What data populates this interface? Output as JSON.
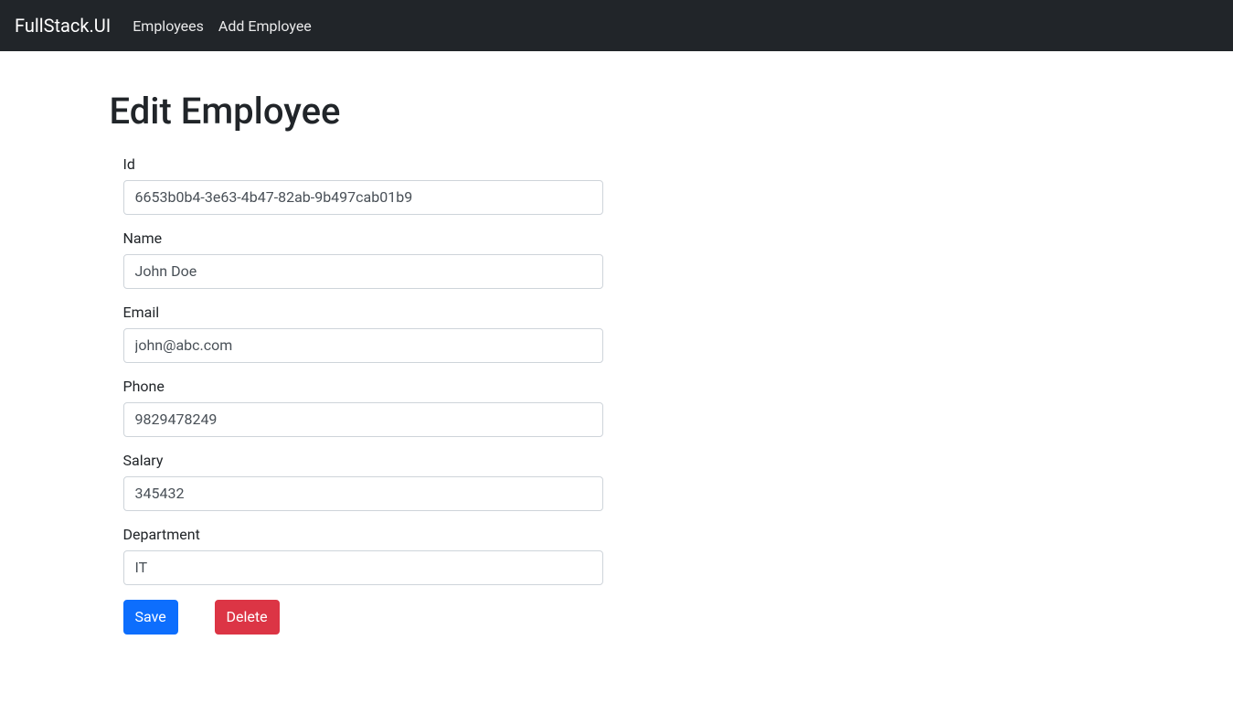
{
  "navbar": {
    "brand": "FullStack.UI",
    "links": {
      "employees": "Employees",
      "add_employee": "Add Employee"
    }
  },
  "page": {
    "title": "Edit Employee"
  },
  "form": {
    "id": {
      "label": "Id",
      "value": "6653b0b4-3e63-4b47-82ab-9b497cab01b9"
    },
    "name": {
      "label": "Name",
      "value": "John Doe"
    },
    "email": {
      "label": "Email",
      "value": "john@abc.com"
    },
    "phone": {
      "label": "Phone",
      "value": "9829478249"
    },
    "salary": {
      "label": "Salary",
      "value": "345432"
    },
    "department": {
      "label": "Department",
      "value": "IT"
    }
  },
  "buttons": {
    "save": "Save",
    "delete": "Delete"
  }
}
